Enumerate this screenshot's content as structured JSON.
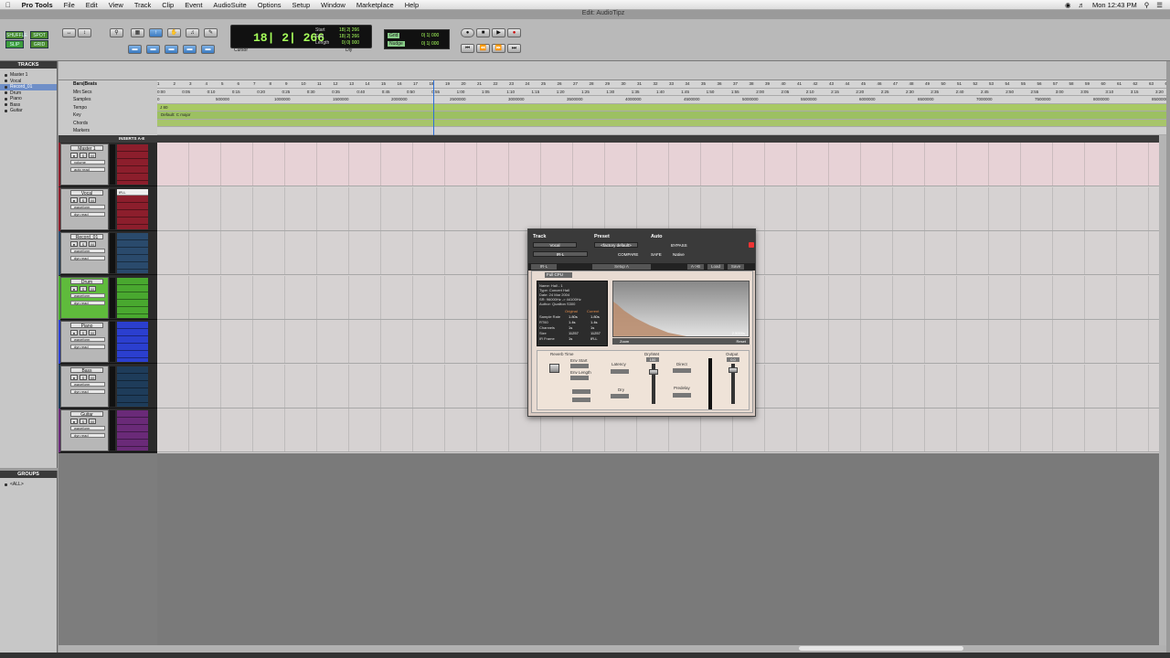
{
  "menubar": {
    "app": "Pro Tools",
    "items": [
      "File",
      "Edit",
      "View",
      "Track",
      "Clip",
      "Event",
      "AudioSuite",
      "Options",
      "Setup",
      "Window",
      "Marketplace",
      "Help"
    ],
    "clock": "Mon 12:43 PM"
  },
  "window_title": "Edit: AudioTipz",
  "modes": {
    "shuffle": "SHUFFLE",
    "spot": "SPOT",
    "slip": "SLIP",
    "grid": "GRID"
  },
  "counter": {
    "main": "18| 2| 266",
    "labels": [
      "Start",
      "End",
      "Length"
    ],
    "values": [
      "18| 2| 266",
      "18| 2| 266",
      "0| 0| 000"
    ],
    "cursor_label": "Cursor",
    "dly": "Dly"
  },
  "grid_nudge": {
    "grid_label": "Grid",
    "nudge_label": "Nudge",
    "grid_value": "0| 1| 000",
    "nudge_value": "0| 1| 000"
  },
  "tracks_panel": {
    "title": "TRACKS",
    "items": [
      "Master 1",
      "Vocal",
      "Record_01",
      "Drum",
      "Piano",
      "Bass",
      "Guitar"
    ]
  },
  "groups_panel": {
    "title": "GROUPS",
    "items": [
      "<ALL>"
    ]
  },
  "rulers": {
    "labels": [
      "Bars|Beats",
      "Min:Secs",
      "Samples",
      "Tempo",
      "Key",
      "Chords",
      "Markers"
    ],
    "bars": [
      "1",
      "2",
      "3",
      "4",
      "5",
      "6",
      "7",
      "8",
      "9",
      "10",
      "11",
      "12",
      "13",
      "14",
      "15",
      "16",
      "17",
      "18",
      "19",
      "20",
      "21",
      "22",
      "23",
      "24",
      "25",
      "26",
      "27",
      "28",
      "29",
      "30",
      "31",
      "32",
      "33",
      "34",
      "35",
      "36",
      "37",
      "38",
      "39",
      "40",
      "41",
      "42",
      "43",
      "44",
      "45",
      "46",
      "47",
      "48",
      "49",
      "50",
      "51",
      "52",
      "53",
      "54",
      "55",
      "56",
      "57",
      "58",
      "59",
      "60",
      "61",
      "62",
      "63",
      "64",
      "65",
      "66",
      "67"
    ],
    "minsecs": [
      "0:00",
      "0:05",
      "0:10",
      "0:15",
      "0:20",
      "0:25",
      "0:30",
      "0:35",
      "0:40",
      "0:45",
      "0:50",
      "0:55",
      "1:00",
      "1:05",
      "1:10",
      "1:15",
      "1:20",
      "1:25",
      "1:30",
      "1:35",
      "1:40",
      "1:45",
      "1:50",
      "1:55",
      "2:00",
      "2:05",
      "2:10",
      "2:15",
      "2:20",
      "2:25",
      "2:30",
      "2:35",
      "2:40",
      "2:45",
      "2:50",
      "2:55",
      "3:00",
      "3:05",
      "3:10",
      "3:15",
      "3:20"
    ],
    "samples": [
      "0",
      "500000",
      "1000000",
      "1500000",
      "2000000",
      "2500000",
      "3000000",
      "3500000",
      "4000000",
      "4500000",
      "5000000",
      "5500000",
      "6000000",
      "6500000",
      "7000000",
      "7500000",
      "8000000",
      "8500000"
    ],
    "tempo_value": "J 80",
    "key_value": "Default: C major",
    "inserts_header": "INSERTS A-E"
  },
  "tracks": [
    {
      "name": "Master 1",
      "color": "#8c1e2c",
      "sel1": "volume",
      "sel2": "auto read",
      "sel3": "",
      "insert": ""
    },
    {
      "name": "Vocal",
      "color": "#8c1e2c",
      "sel1": "waveform",
      "sel2": "dyn   read",
      "sel3": "",
      "insert": "IR-L"
    },
    {
      "name": "Record_01",
      "color": "#2a4a6c",
      "sel1": "waveform",
      "sel2": "dyn   read",
      "sel3": "",
      "insert": ""
    },
    {
      "name": "Drum",
      "color": "#49a82f",
      "sel1": "waveform",
      "sel2": "dyn   read",
      "sel3": "",
      "insert": ""
    },
    {
      "name": "Piano",
      "color": "#2b3fcf",
      "sel1": "waveform",
      "sel2": "dyn   read",
      "sel3": "",
      "insert": ""
    },
    {
      "name": "Bass",
      "color": "#1e3c5a",
      "sel1": "waveform",
      "sel2": "dyn   read",
      "sel3": "",
      "insert": ""
    },
    {
      "name": "Guitar",
      "color": "#6a2a78",
      "sel1": "waveform",
      "sel2": "dyn   read",
      "sel3": "",
      "insert": ""
    }
  ],
  "plugin": {
    "track_label": "Track",
    "preset_label": "Preset",
    "auto_label": "Auto",
    "track_value": "Vocal",
    "insert_value": "IR-L",
    "preset_value": "<factory default>",
    "compare": "COMPARE",
    "safe": "SAFE",
    "bypass": "BYPASS",
    "native": "Native",
    "bar_items": [
      "IR-L",
      "Setup A",
      "A->B",
      "Load",
      "Save"
    ],
    "cpu": "Full CPU",
    "info_labels": [
      "Name: Hall - 1",
      "Type: Concert Hall",
      "Date: 24 Mar 2004",
      "SR: 96000Hz -> 44100Hz",
      "Author: Qualiton S300"
    ],
    "info_header": [
      "Original",
      "Current"
    ],
    "info_rows": [
      [
        "Sample Rate",
        "1.80s",
        "1.80s"
      ],
      [
        "RT60",
        "1.4s",
        "1.4s"
      ],
      [
        "Channels",
        "1s",
        "1s"
      ],
      [
        "Size",
        "11257",
        "11257"
      ],
      [
        "IR Frame",
        "1s",
        "IR-L"
      ]
    ],
    "zoom": "Zoom",
    "reset": "Reset",
    "time": "2.5000s",
    "reverb_time": "Reverb Time",
    "dry_wet": "Dry/Wet",
    "output": "Output",
    "latency": "Latency",
    "direct": "Direct",
    "predelay": "Predelay",
    "dry": "Dry",
    "env_start": "Env Start",
    "env_length": "Env Length",
    "dry_wet_value": "100",
    "output_value": "0.0"
  }
}
